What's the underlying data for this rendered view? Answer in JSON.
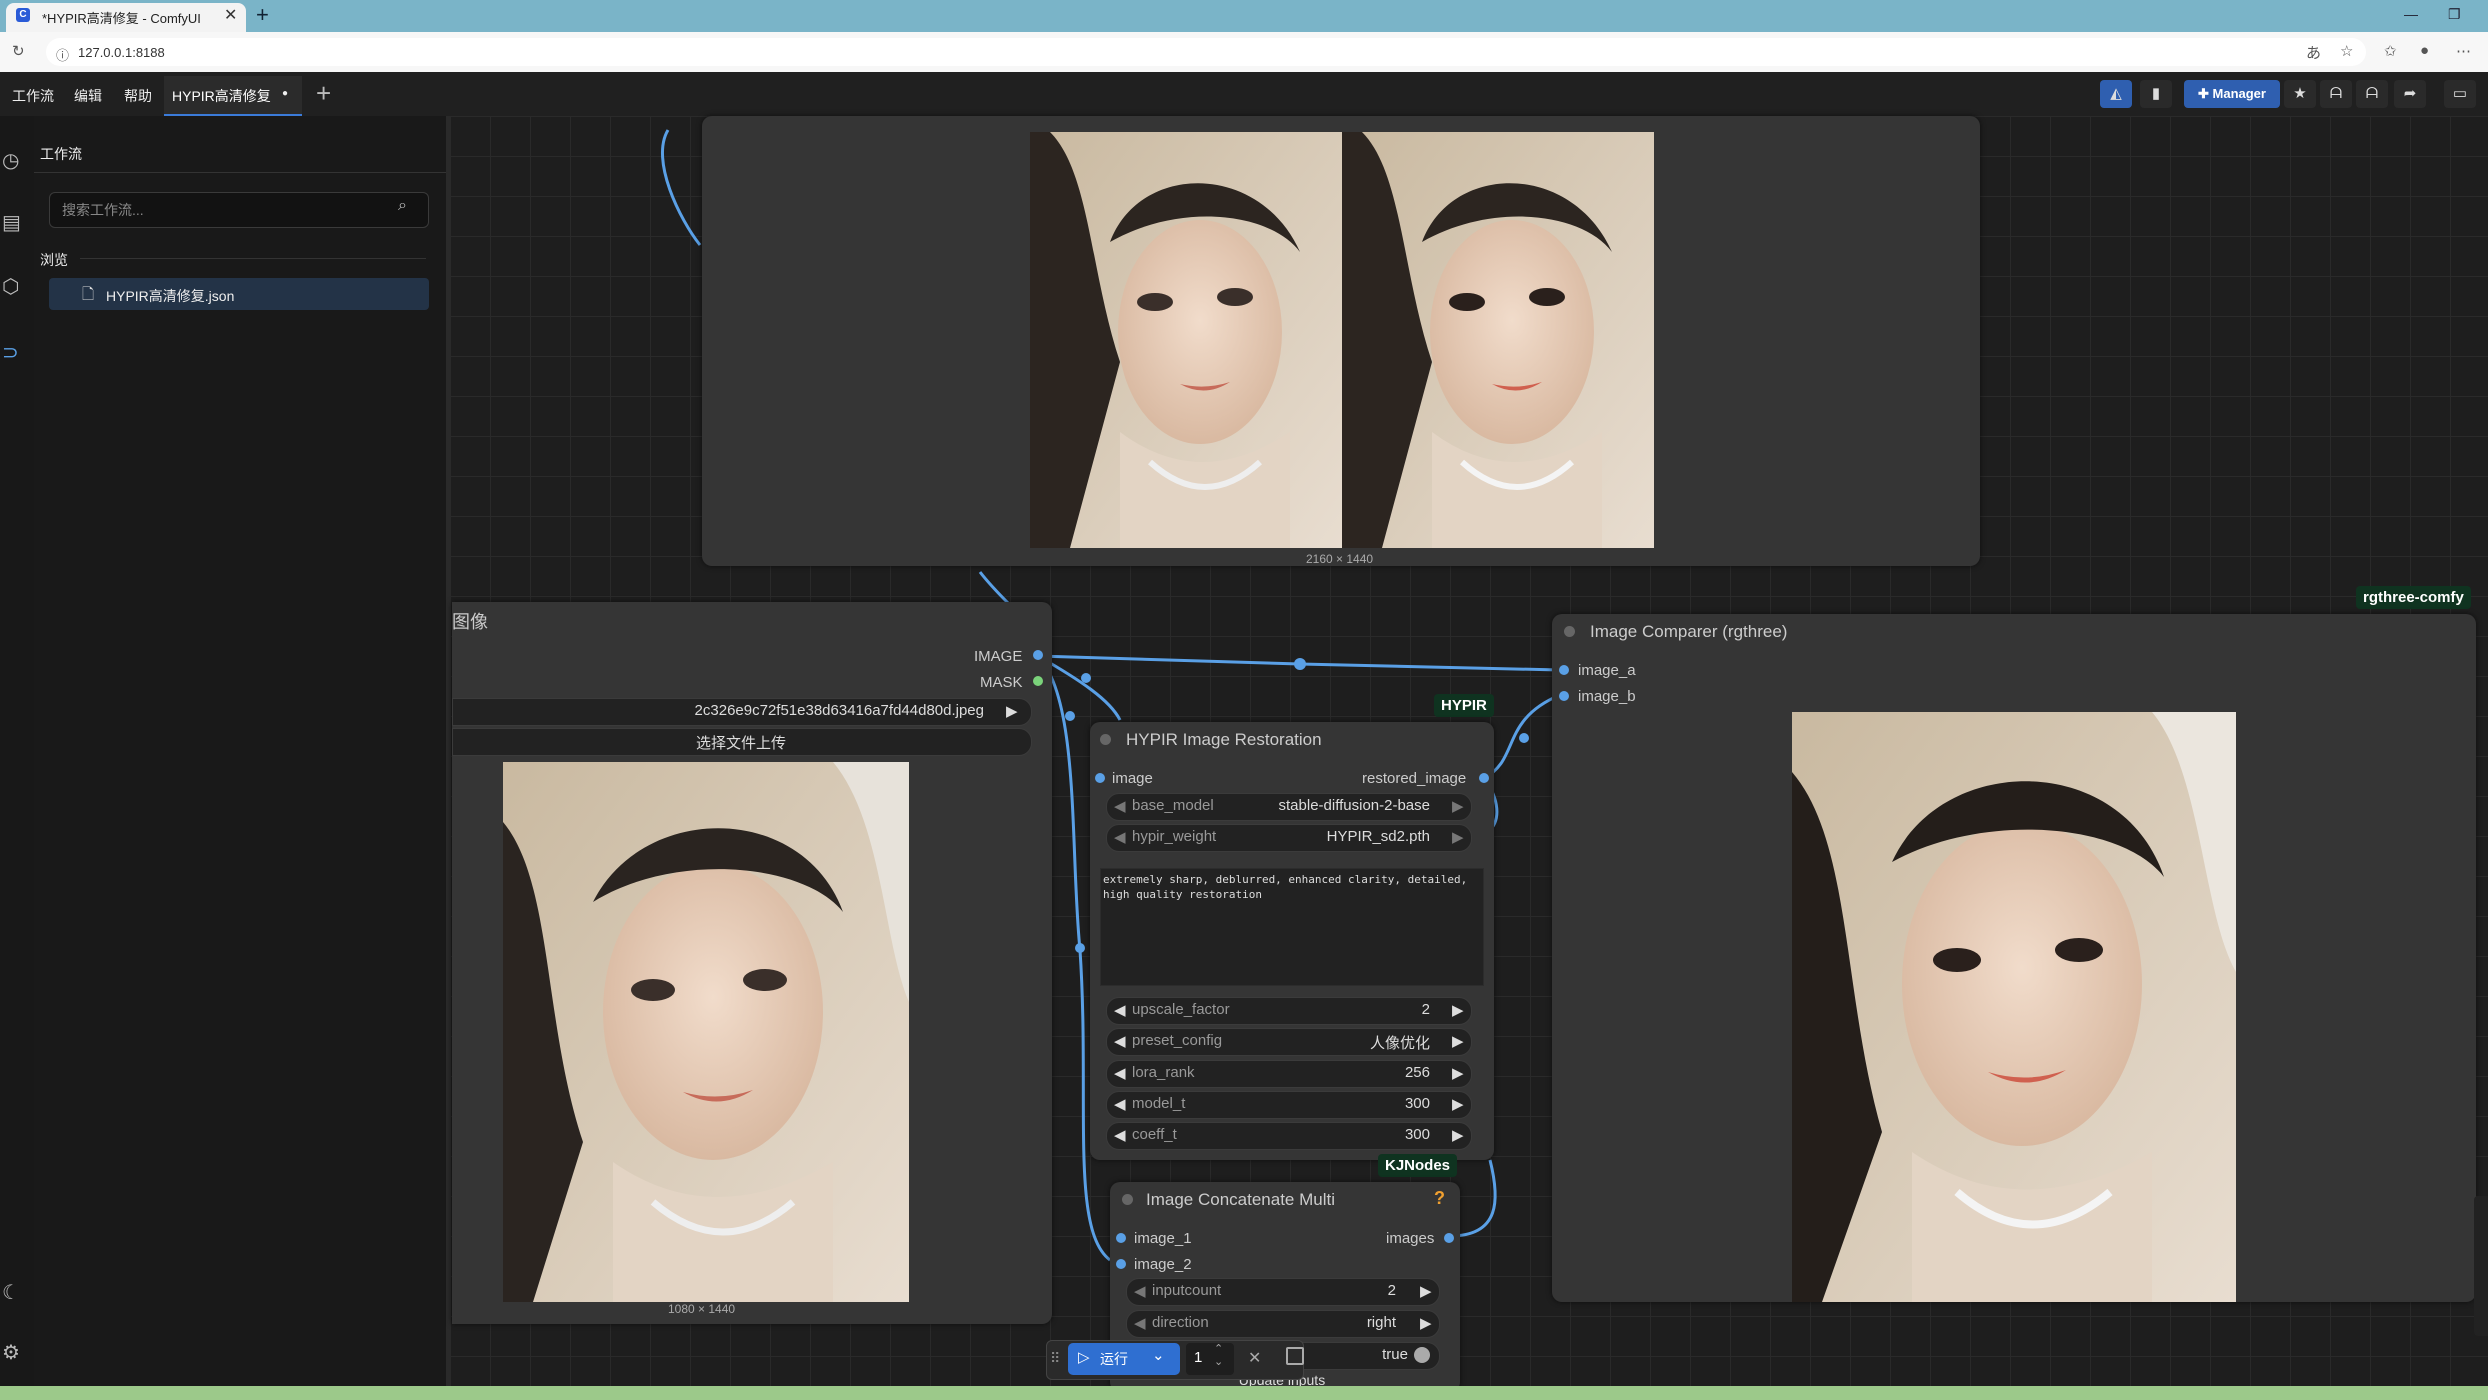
{
  "browser": {
    "tab_title": "*HYPIR高清修复 - ComfyUI",
    "url": "127.0.0.1:8188"
  },
  "menu": {
    "items": [
      "工作流",
      "编辑",
      "帮助"
    ],
    "workflow_tab": "HYPIR高清修复",
    "manager_label": "Manager"
  },
  "sidebar": {
    "title": "工作流",
    "search_placeholder": "搜索工作流...",
    "browse_label": "浏览",
    "files": [
      "HYPIR高清修复.json"
    ]
  },
  "nodes": {
    "preview_top": {
      "dimensions": "2160 × 1440"
    },
    "load_image": {
      "title": "图像",
      "outputs": [
        "IMAGE",
        "MASK"
      ],
      "filename": "2c326e9c72f51e38d63416a7fd44d80d.jpeg",
      "upload_label": "选择文件上传",
      "dimensions": "1080 × 1440"
    },
    "hypir": {
      "badge": "HYPIR",
      "title": "HYPIR Image Restoration",
      "input": "image",
      "output": "restored_image",
      "base_model_label": "base_model",
      "base_model_value": "stable-diffusion-2-base",
      "hypir_weight_label": "hypir_weight",
      "hypir_weight_value": "HYPIR_sd2.pth",
      "prompt": "extremely sharp, deblurred, enhanced clarity, detailed, high quality restoration",
      "params": [
        {
          "label": "upscale_factor",
          "value": "2"
        },
        {
          "label": "preset_config",
          "value": "人像优化"
        },
        {
          "label": "lora_rank",
          "value": "256"
        },
        {
          "label": "model_t",
          "value": "300"
        },
        {
          "label": "coeff_t",
          "value": "300"
        }
      ]
    },
    "concat": {
      "badge": "KJNodes",
      "title": "Image Concatenate Multi",
      "help": "?",
      "inputs": [
        "image_1",
        "image_2"
      ],
      "output": "images",
      "inputcount_label": "inputcount",
      "inputcount_value": "2",
      "direction_label": "direction",
      "direction_value": "right",
      "bool_value": "true",
      "update_label": "Update inputs"
    },
    "comparer": {
      "badge": "rgthree-comfy",
      "title": "Image Comparer (rgthree)",
      "inputs": [
        "image_a",
        "image_b"
      ]
    }
  },
  "runbar": {
    "run_label": "运行",
    "count": "1"
  }
}
